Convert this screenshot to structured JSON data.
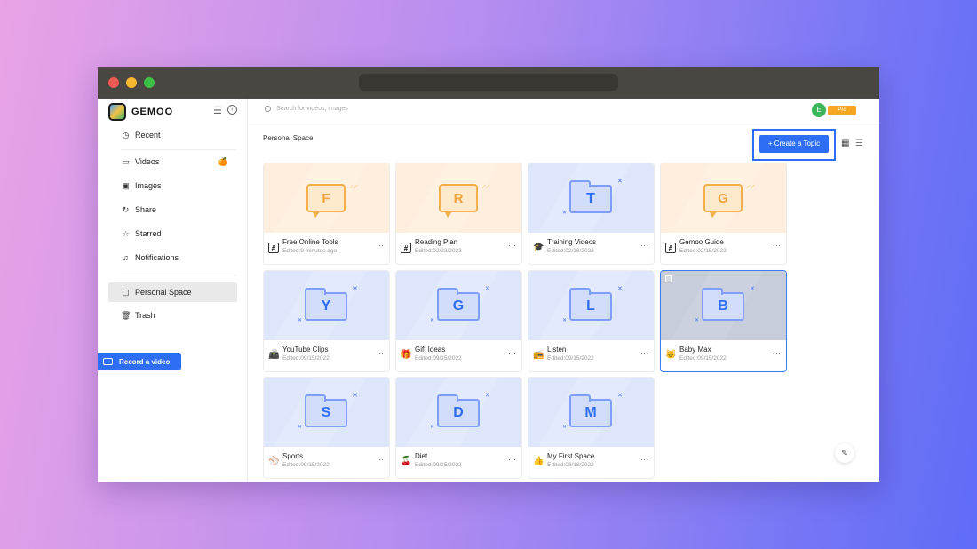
{
  "app": {
    "logo_text": "GEMOO"
  },
  "sidebar": {
    "items": [
      {
        "label": "Recent",
        "icon": "clock-icon",
        "glyph": "◷"
      },
      {
        "label": "Videos",
        "icon": "video-icon",
        "glyph": "▭"
      },
      {
        "label": "Images",
        "icon": "image-icon",
        "glyph": "▣"
      },
      {
        "label": "Share",
        "icon": "share-icon",
        "glyph": "↻"
      },
      {
        "label": "Starred",
        "icon": "star-icon",
        "glyph": "☆"
      },
      {
        "label": "Notifications",
        "icon": "bell-icon",
        "glyph": "♫"
      },
      {
        "label": "Personal Space",
        "icon": "folder-icon",
        "glyph": "▢"
      },
      {
        "label": "Trash",
        "icon": "trash-icon",
        "glyph": "🗑"
      }
    ],
    "videos_badge": "🍊",
    "record_label": "Record a video"
  },
  "header": {
    "search_placeholder": "Search for videos, images",
    "avatar_initial": "E",
    "pro_label": "Pro"
  },
  "main": {
    "title": "Personal Space",
    "create_label": "+ Create a Topic"
  },
  "cards": [
    {
      "letter": "F",
      "name": "Free Online Tools",
      "date": "Edited:9 minutes ago",
      "style": "orange",
      "emoji": "#",
      "hash": true
    },
    {
      "letter": "R",
      "name": "Reading Plan",
      "date": "Edited:02/23/2023",
      "style": "orange",
      "emoji": "#",
      "hash": true
    },
    {
      "letter": "T",
      "name": "Training Videos",
      "date": "Edited:02/18/2023",
      "style": "blue",
      "emoji": "🎓"
    },
    {
      "letter": "G",
      "name": "Gemoo Guide",
      "date": "Edited:02/15/2023",
      "style": "orange",
      "emoji": "#",
      "hash": true
    },
    {
      "letter": "Y",
      "name": "YouTube Clips",
      "date": "Edited:09/15/2022",
      "style": "blue",
      "emoji": "📠"
    },
    {
      "letter": "G",
      "name": "Gift Ideas",
      "date": "Edited:09/15/2022",
      "style": "blue",
      "emoji": "🎁"
    },
    {
      "letter": "L",
      "name": "Listen",
      "date": "Edited:09/15/2022",
      "style": "blue",
      "emoji": "📻"
    },
    {
      "letter": "B",
      "name": "Baby Max",
      "date": "Edited:09/15/2022",
      "style": "dark",
      "emoji": "🐱",
      "selected": true
    },
    {
      "letter": "S",
      "name": "Sports",
      "date": "Edited:09/15/2022",
      "style": "blue",
      "emoji": "⚾"
    },
    {
      "letter": "D",
      "name": "Diet",
      "date": "Edited:09/15/2022",
      "style": "blue",
      "emoji": "🍒"
    },
    {
      "letter": "M",
      "name": "My First Space",
      "date": "Edited:08/18/2022",
      "style": "blue",
      "emoji": "👍"
    }
  ],
  "colors": {
    "accent": "#2e6ef5",
    "pro": "#f5a623",
    "orange_folder": "#f3b04a"
  }
}
